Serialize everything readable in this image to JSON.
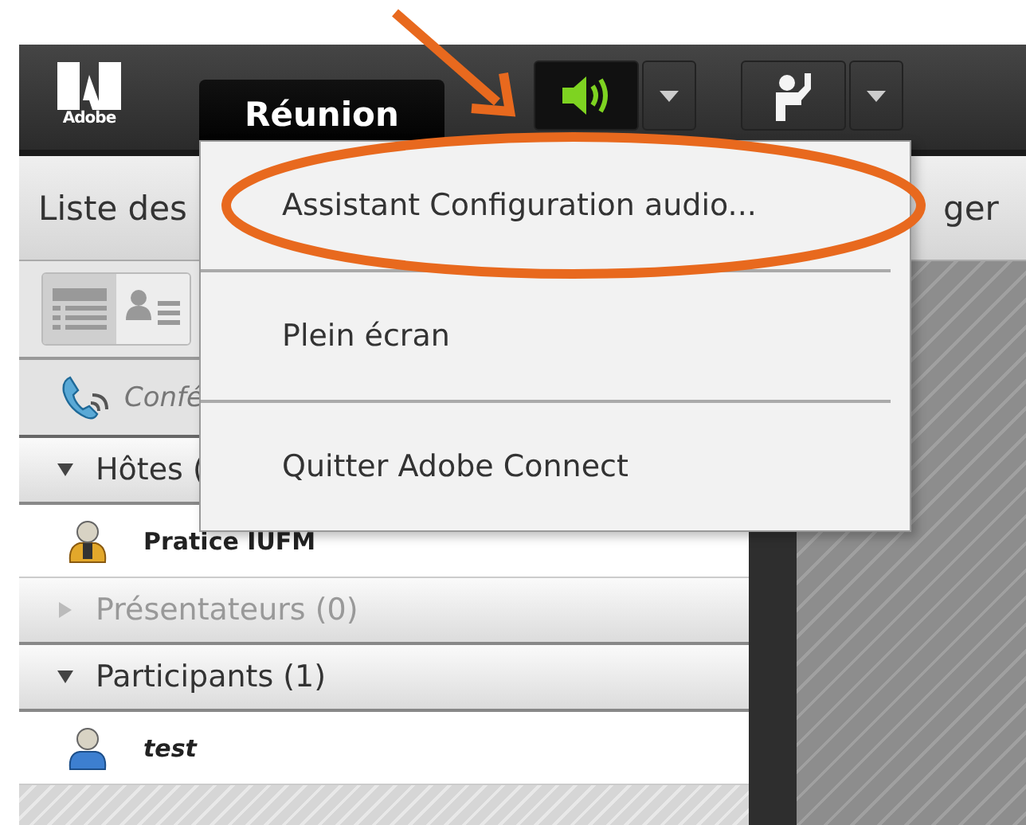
{
  "toolbar": {
    "logo_text": "Adobe",
    "meeting_menu": {
      "label": "Réunion",
      "selected": true
    },
    "audio": {
      "on": true
    }
  },
  "menu": {
    "items": [
      {
        "label": "Assistant Configuration audio..."
      },
      {
        "label": "Plein écran"
      },
      {
        "label": "Quitter Adobe Connect"
      }
    ]
  },
  "left_panel": {
    "title": "Liste des",
    "view_buttons": [
      {
        "kind": "list",
        "selected": true
      },
      {
        "kind": "card",
        "selected": false
      }
    ],
    "conference": "Confé",
    "groups": [
      {
        "label": "Hôtes (",
        "expanded": true,
        "disabled": false,
        "children": [
          {
            "name": "Pratice IUFM",
            "kind": "host",
            "me": false
          }
        ]
      },
      {
        "label": "Présentateurs (0)",
        "expanded": false,
        "disabled": true
      },
      {
        "label": "Participants (1)",
        "expanded": true,
        "disabled": false,
        "children": [
          {
            "name": "test",
            "kind": "participant",
            "me": true
          }
        ]
      }
    ]
  },
  "right_panel": {
    "title": "ger"
  },
  "annotations": {
    "arrow": true,
    "ellipse": true
  }
}
